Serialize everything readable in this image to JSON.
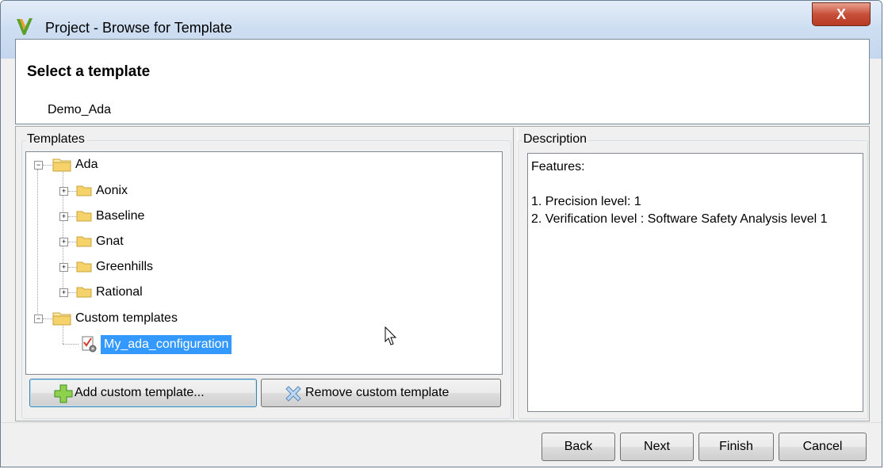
{
  "window": {
    "title": "Project - Browse for Template",
    "close_label": "X"
  },
  "header": {
    "title": "Select a template",
    "selected_template": "Demo_Ada"
  },
  "templates": {
    "group_label": "Templates",
    "tree": {
      "ada": {
        "label": "Ada",
        "expanded": true,
        "children": [
          "Aonix",
          "Baseline",
          "Gnat",
          "Greenhills",
          "Rational"
        ]
      },
      "custom": {
        "label": "Custom templates",
        "expanded": true,
        "children": [
          "My_ada_configuration"
        ]
      }
    },
    "add_button": "Add custom template...",
    "remove_button": "Remove custom template"
  },
  "description": {
    "group_label": "Description",
    "lines": [
      "Features:",
      "",
      "1. Precision level: 1",
      "2. Verification level : Software Safety Analysis level 1"
    ]
  },
  "footer": {
    "back": "Back",
    "next": "Next",
    "finish": "Finish",
    "cancel": "Cancel"
  },
  "colors": {
    "selection": "#3399ff",
    "folder": "#f5d26a",
    "close_button": "#c7503a"
  }
}
